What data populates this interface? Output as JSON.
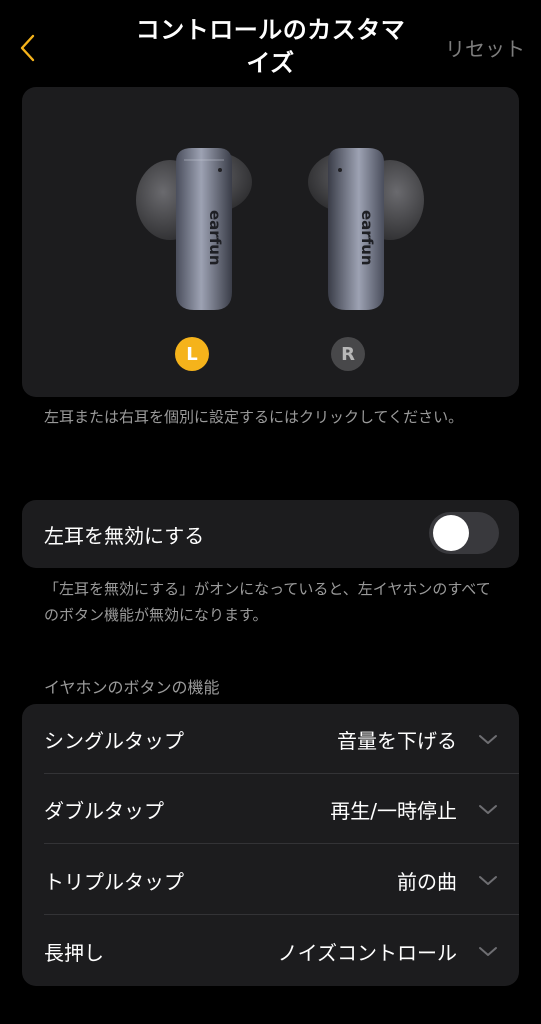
{
  "header": {
    "title": "コントロールのカスタマイズ",
    "reset_label": "リセット",
    "accent_color": "#f5b31b"
  },
  "hero": {
    "left_badge": "L",
    "right_badge": "R",
    "brand_text": "earfun",
    "selected_ear": "L"
  },
  "hint_text": "左耳または右耳を個別に設定するにはクリックしてください。",
  "disable_toggle": {
    "label": "左耳を無効にする",
    "enabled": false,
    "note": "「左耳を無効にする」がオンになっていると、左イヤホンのすべてのボタン機能が無効になります。"
  },
  "buttons_section": {
    "label": "イヤホンのボタンの機能",
    "rows": [
      {
        "label": "シングルタップ",
        "value": "音量を下げる"
      },
      {
        "label": "ダブルタップ",
        "value": "再生/一時停止"
      },
      {
        "label": "トリプルタップ",
        "value": "前の曲"
      },
      {
        "label": "長押し",
        "value": "ノイズコントロール"
      }
    ]
  }
}
